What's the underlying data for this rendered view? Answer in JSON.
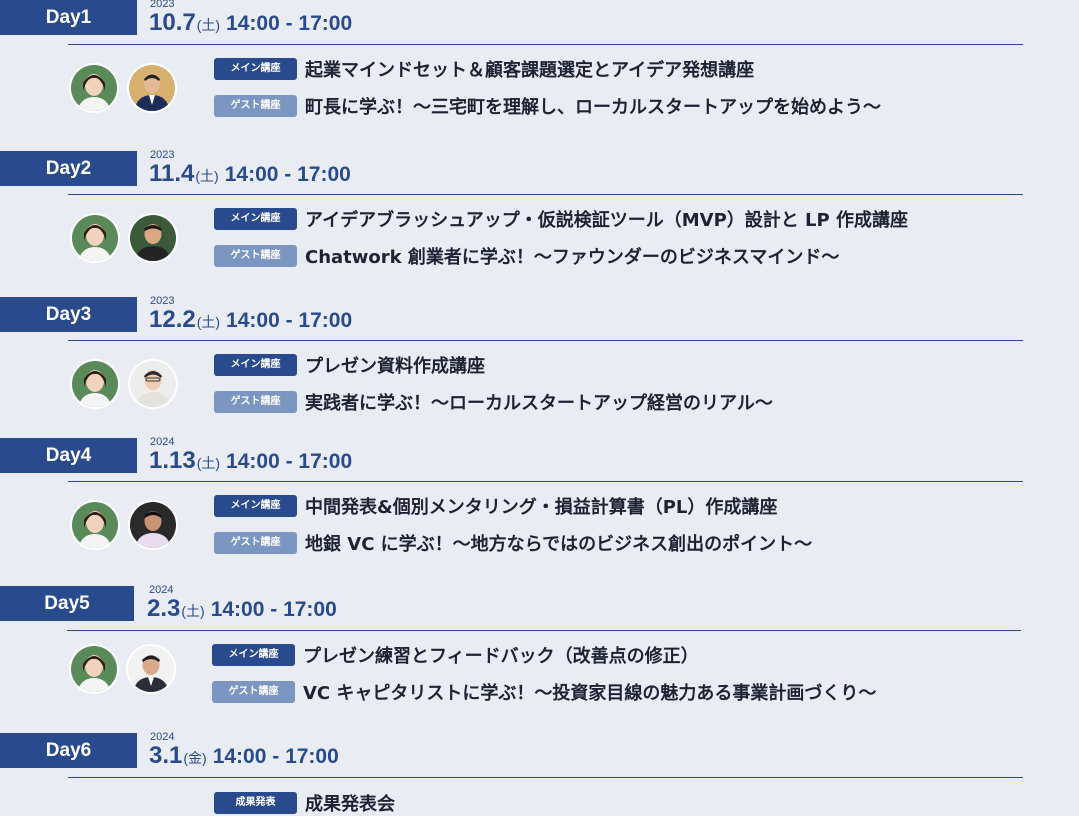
{
  "days": [
    {
      "label": "Day1",
      "year": "2023",
      "date": "10.7",
      "dow": "(土)",
      "time": "14:00 - 17:00",
      "sessions": [
        {
          "badge": "メイン講座",
          "title": "起業マインドセット＆顧客課題選定とアイデア発想講座"
        },
        {
          "badge": "ゲスト講座",
          "title": "町長に学ぶ！〜三宅町を理解し、ローカルスタートアップを始めよう〜"
        }
      ]
    },
    {
      "label": "Day2",
      "year": "2023",
      "date": "11.4",
      "dow": "(土)",
      "time": "14:00 - 17:00",
      "sessions": [
        {
          "badge": "メイン講座",
          "title": "アイデアブラッシュアップ・仮説検証ツール（MVP）設計と LP 作成講座"
        },
        {
          "badge": "ゲスト講座",
          "title": "Chatwork 創業者に学ぶ！〜ファウンダーのビジネスマインド〜"
        }
      ]
    },
    {
      "label": "Day3",
      "year": "2023",
      "date": "12.2",
      "dow": "(土)",
      "time": "14:00 - 17:00",
      "sessions": [
        {
          "badge": "メイン講座",
          "title": "プレゼン資料作成講座"
        },
        {
          "badge": "ゲスト講座",
          "title": "実践者に学ぶ！〜ローカルスタートアップ経営のリアル〜"
        }
      ]
    },
    {
      "label": "Day4",
      "year": "2024",
      "date": "1.13",
      "dow": "(土)",
      "time": "14:00 - 17:00",
      "sessions": [
        {
          "badge": "メイン講座",
          "title": "中間発表&個別メンタリング・損益計算書（PL）作成講座"
        },
        {
          "badge": "ゲスト講座",
          "title": "地銀 VC に学ぶ！〜地方ならではのビジネス創出のポイント〜"
        }
      ]
    },
    {
      "label": "Day5",
      "year": "2024",
      "date": "2.3",
      "dow": "(土)",
      "time": "14:00 - 17:00",
      "sessions": [
        {
          "badge": "メイン講座",
          "title": "プレゼン練習とフィードバック（改善点の修正）"
        },
        {
          "badge": "ゲスト講座",
          "title": "VC キャピタリストに学ぶ！〜投資家目線の魅力ある事業計画づくり〜"
        }
      ]
    },
    {
      "label": "Day6",
      "year": "2024",
      "date": "3.1",
      "dow": "(金)",
      "time": "14:00 - 17:00",
      "sessions": [
        {
          "badge": "成果発表",
          "title": "成果発表会"
        }
      ]
    }
  ]
}
